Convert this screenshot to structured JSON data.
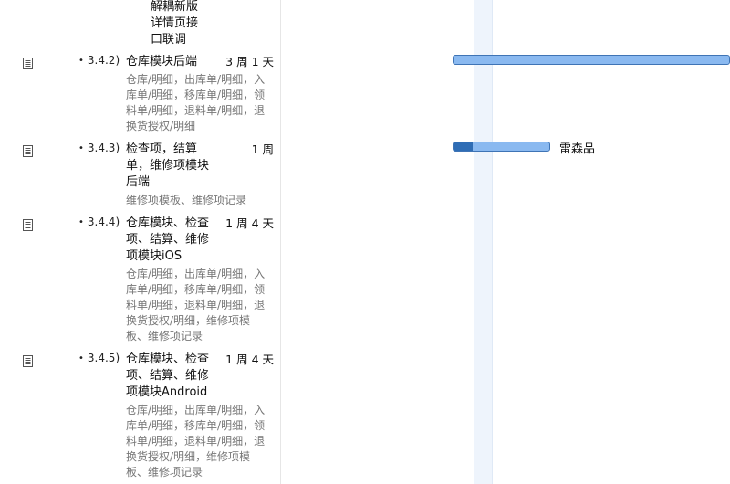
{
  "top_fragment": {
    "title": "解耦新版详情页接口联调"
  },
  "rows": [
    {
      "wbs": "3.4.2)",
      "title": "仓库模块后端",
      "duration": "3 周 1 天",
      "notes": "仓库/明细，出库单/明细，入库单/明细，移库单/明细，领料单/明细，退料单/明细，退换货授权/明细"
    },
    {
      "wbs": "3.4.3)",
      "title": "检查项，结算单，维修项模块后端",
      "duration": "1 周",
      "notes": "维修项模板、维修项记录",
      "progress": 0.2,
      "resource": "雷森品"
    },
    {
      "wbs": "3.4.4)",
      "title": "仓库模块、检查项、结算、维修项模块iOS",
      "duration": "1 周 4 天",
      "notes": "仓库/明细，出库单/明细，入库单/明细，移库单/明细，领料单/明细，退料单/明细，退换货授权/明细，维修项模板、维修项记录"
    },
    {
      "wbs": "3.4.5)",
      "title": "仓库模块、检查项、结算、维修项模块Android",
      "duration": "1 周 4 天",
      "notes": "仓库/明细，出库单/明细，入库单/明细，移库单/明细，领料单/明细，退料单/明细，退换货授权/明细，维修项模板、维修项记录"
    }
  ],
  "bullet": "•",
  "icons": {
    "row_icon": "document-icon"
  },
  "colors": {
    "bar_fill": "#8ab9f0",
    "bar_progress": "#2f6db5",
    "bar_border": "#3f74b5",
    "today_column": "#eef4fc"
  }
}
